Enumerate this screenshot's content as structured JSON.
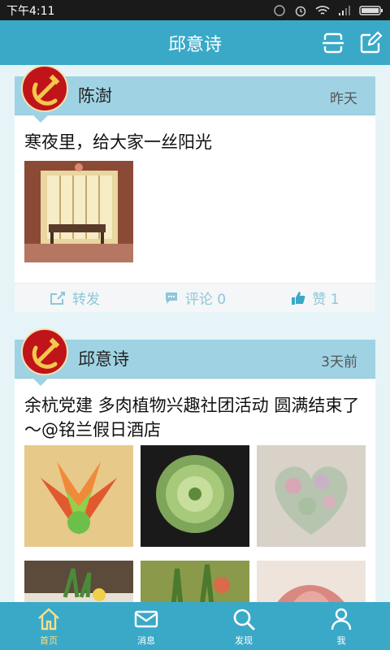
{
  "statusbar": {
    "time": "下午4:11"
  },
  "header": {
    "title": "邱意诗"
  },
  "posts": [
    {
      "user": "陈澍",
      "time": "昨天",
      "text": "寒夜里，给大家一丝阳光",
      "actions": {
        "repost": "转发",
        "comment": "评论 0",
        "like": "赞 1"
      }
    },
    {
      "user": "邱意诗",
      "time": "3天前",
      "text": "余杭党建 多肉植物兴趣社团活动 圆满结束了～@铭兰假日酒店"
    }
  ],
  "nav": [
    {
      "label": "首页",
      "icon": "home-icon",
      "active": true
    },
    {
      "label": "消息",
      "icon": "mail-icon",
      "active": false
    },
    {
      "label": "发现",
      "icon": "search-icon",
      "active": false
    },
    {
      "label": "我",
      "icon": "person-icon",
      "active": false
    }
  ],
  "colors": {
    "primary": "#3aa9c8",
    "card_header": "#9fd3e4",
    "active_nav": "#f4e08a"
  }
}
